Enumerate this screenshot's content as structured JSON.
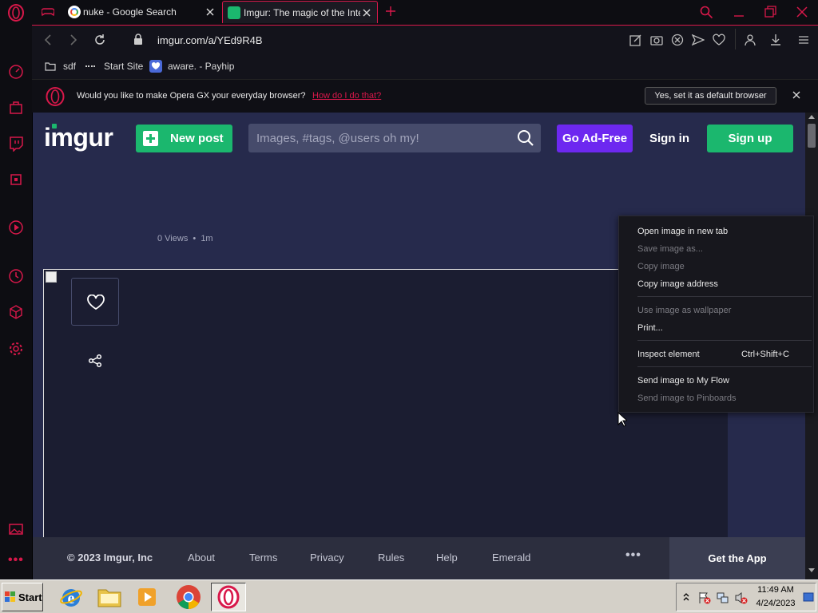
{
  "browser": {
    "tabs": [
      {
        "title": "nuke - Google Search",
        "icon": "google-g-icon"
      },
      {
        "title": "Imgur: The magic of the Inter",
        "icon": "imgur-favicon-icon",
        "active": true
      }
    ],
    "url": "imgur.com/a/YEd9R4B",
    "bookmarks": [
      {
        "label": "sdf",
        "icon": "folder-icon"
      },
      {
        "label": "Start Site",
        "icon": "dash-icon"
      },
      {
        "label": "aware. - Payhip",
        "icon": "payhip-heart-icon"
      }
    ],
    "infobar": {
      "message": "Would you like to make Opera GX your everyday browser?",
      "link": "How do I do that?",
      "button": "Yes, set it as default browser"
    },
    "accent_color": "#d8184a"
  },
  "imgur": {
    "logo": "imgur",
    "new_post": "New post",
    "search_placeholder": "Images, #tags, @users oh my!",
    "go_ad_free": "Go Ad-Free",
    "sign_in": "Sign in",
    "sign_up": "Sign up",
    "meta": {
      "views": "0 Views",
      "sep": "•",
      "age": "1m"
    },
    "footer": {
      "copyright": "© 2023 Imgur, Inc",
      "links": [
        "About",
        "Terms",
        "Privacy",
        "Rules",
        "Help",
        "Emerald"
      ],
      "more": "•••",
      "get_app": "Get the App"
    },
    "colors": {
      "bg": "#262a4c",
      "green": "#1bb76e",
      "purple": "#6d28f0"
    }
  },
  "context_menu": {
    "items": [
      {
        "label": "Open image in new tab",
        "enabled": true
      },
      {
        "label": "Save image as...",
        "enabled": false
      },
      {
        "label": "Copy image",
        "enabled": false
      },
      {
        "label": "Copy image address",
        "enabled": true
      },
      {
        "label": "Use image as wallpaper",
        "enabled": false
      },
      {
        "label": "Print...",
        "enabled": true
      },
      {
        "label": "Inspect element",
        "shortcut": "Ctrl+Shift+C",
        "enabled": true
      },
      {
        "label": "Send image to My Flow",
        "enabled": true
      },
      {
        "label": "Send image to Pinboards",
        "enabled": false
      }
    ]
  },
  "taskbar": {
    "start": "Start",
    "clock": {
      "time": "11:49 AM",
      "date": "4/24/2023"
    }
  }
}
